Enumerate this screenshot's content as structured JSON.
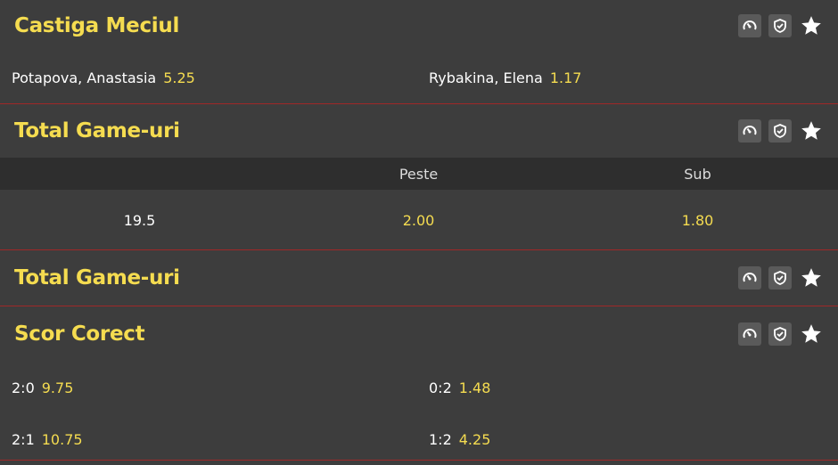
{
  "markets": {
    "winner": {
      "title": "Castiga Meciul",
      "outcomes": [
        {
          "name": "Potapova, Anastasia",
          "odd": "5.25"
        },
        {
          "name": "Rybakina, Elena",
          "odd": "1.17"
        }
      ]
    },
    "total1": {
      "title": "Total Game-uri",
      "col_over": "Peste",
      "col_under": "Sub",
      "line": "19.5",
      "over_odd": "2.00",
      "under_odd": "1.80"
    },
    "total2": {
      "title": "Total Game-uri"
    },
    "correct": {
      "title": "Scor Corect",
      "rows": [
        {
          "left_score": "2:0",
          "left_odd": "9.75",
          "right_score": "0:2",
          "right_odd": "1.48"
        },
        {
          "left_score": "2:1",
          "left_odd": "10.75",
          "right_score": "1:2",
          "right_odd": "4.25"
        }
      ]
    }
  },
  "icons": [
    "speedometer-icon",
    "shield-check-icon",
    "star-icon"
  ],
  "colors": {
    "accent": "#f5dc50",
    "background": "#3d3d3d",
    "divider": "#a02828",
    "subheader": "#2e2e2e"
  }
}
